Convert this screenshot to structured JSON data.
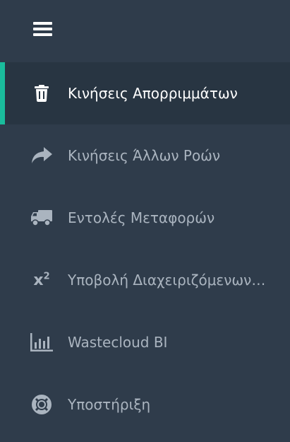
{
  "colors": {
    "background": "#2f3c4b",
    "active_background": "#283542",
    "accent": "#1abc9c",
    "active_text": "#ffffff",
    "inactive_text": "#aab4bf"
  },
  "header": {
    "menu_icon": "hamburger-menu-icon"
  },
  "nav": {
    "items": [
      {
        "label": "Κινήσεις Απορριμμάτων",
        "icon": "trash-icon",
        "active": true
      },
      {
        "label": "Κινήσεις Άλλων Ροών",
        "icon": "share-arrow-icon",
        "active": false
      },
      {
        "label": "Εντολές Μεταφορών",
        "icon": "truck-icon",
        "active": false
      },
      {
        "label": "Υποβολή Διαχειριζόμενων…",
        "icon": "superscript-icon",
        "icon_text": "x",
        "icon_sup": "2",
        "active": false
      },
      {
        "label": "Wastecloud BI",
        "icon": "bar-chart-icon",
        "active": false
      },
      {
        "label": "Υποστήριξη",
        "icon": "life-ring-icon",
        "active": false
      }
    ]
  }
}
